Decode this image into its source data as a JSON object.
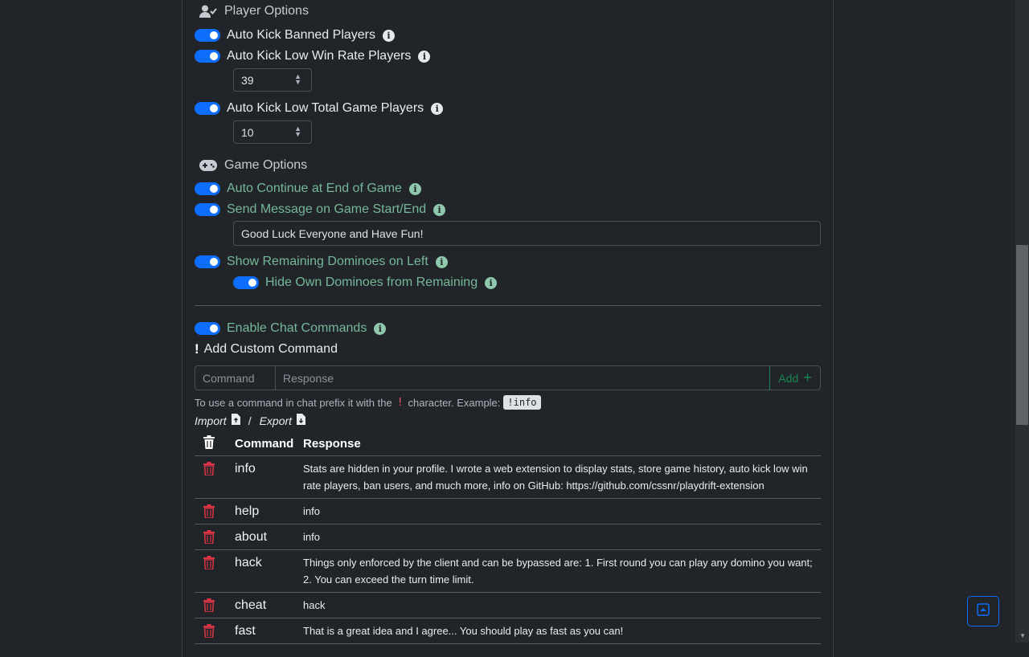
{
  "player_options": {
    "title": "Player Options",
    "auto_kick_banned": "Auto Kick Banned Players",
    "auto_kick_low_win": "Auto Kick Low Win Rate Players",
    "low_win_value": "39",
    "auto_kick_low_total": "Auto Kick Low Total Game Players",
    "low_total_value": "10"
  },
  "game_options": {
    "title": "Game Options",
    "auto_continue": "Auto Continue at End of Game",
    "send_message": "Send Message on Game Start/End",
    "message_value": "Good Luck Everyone and Have Fun!",
    "show_remaining": "Show Remaining Dominoes on Left",
    "hide_own": "Hide Own Dominoes from Remaining"
  },
  "chat": {
    "enable_label": "Enable Chat Commands",
    "add_title": "Add Custom Command",
    "command_placeholder": "Command",
    "response_placeholder": "Response",
    "add_label": "Add",
    "hint_before": "To use a command in chat prefix it with the",
    "hint_char": "!",
    "hint_after": "character. Example:",
    "hint_example": "!info",
    "import_label": "Import",
    "slash": "/",
    "export_label": "Export"
  },
  "table": {
    "headers": [
      "Command",
      "Response"
    ],
    "rows": [
      {
        "command": "info",
        "response": "Stats are hidden in your profile. I wrote a web extension to display stats, store game history, auto kick low win rate players, ban users, and much more, info on GitHub: https://github.com/cssnr/playdrift-extension"
      },
      {
        "command": "help",
        "response": "info"
      },
      {
        "command": "about",
        "response": "info"
      },
      {
        "command": "hack",
        "response": "Things only enforced by the client and can be bypassed are: 1. First round you can play any domino you want; 2. You can exceed the turn time limit."
      },
      {
        "command": "cheat",
        "response": "hack"
      },
      {
        "command": "fast",
        "response": "That is a great idea and I agree... You should play as fast as you can!"
      }
    ]
  },
  "colors": {
    "background": "#212529",
    "accent": "#0d6efd",
    "success": "#198754",
    "danger": "#dc3545",
    "green_text": "#75b798"
  }
}
